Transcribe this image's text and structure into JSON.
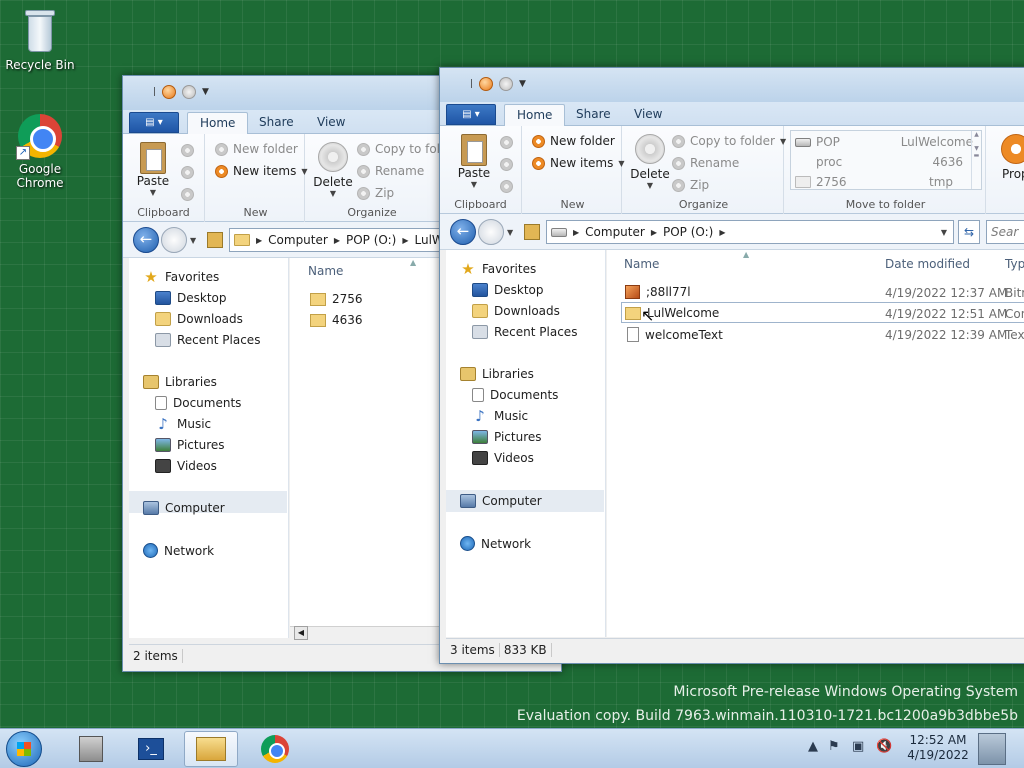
{
  "desktop": {
    "icons": [
      {
        "label": "Recycle Bin",
        "icon": "recycle-bin-icon"
      },
      {
        "label": "Google\nChrome",
        "icon": "chrome-icon"
      }
    ]
  },
  "window_back": {
    "tabs": [
      "Home",
      "Share",
      "View"
    ],
    "ribbon": {
      "paste": "Paste",
      "new_folder": "New folder",
      "new_items": "New items",
      "delete": "Delete",
      "copy_to": "Copy to fold",
      "rename": "Rename",
      "zip": "Zip",
      "groups": [
        "Clipboard",
        "New",
        "Organize"
      ]
    },
    "address": [
      "Computer",
      "POP (O:)",
      "LulW"
    ],
    "nav": {
      "favorites": "Favorites",
      "fav_items": [
        "Desktop",
        "Downloads",
        "Recent Places"
      ],
      "libraries": "Libraries",
      "lib_items": [
        "Documents",
        "Music",
        "Pictures",
        "Videos"
      ],
      "computer": "Computer",
      "network": "Network"
    },
    "column_name": "Name",
    "files": [
      "2756",
      "4636"
    ],
    "status": "2 items"
  },
  "window_front": {
    "tabs": [
      "Home",
      "Share",
      "View"
    ],
    "ribbon": {
      "paste": "Paste",
      "new_folder": "New folder",
      "new_items": "New items",
      "delete": "Delete",
      "copy_to": "Copy to folder",
      "rename": "Rename",
      "zip": "Zip",
      "move_list": [
        {
          "left": "POP",
          "right": "LulWelcome"
        },
        {
          "left": "proc",
          "right": "4636"
        },
        {
          "left": "2756",
          "right": "tmp"
        }
      ],
      "properties": "Prop",
      "groups": [
        "Clipboard",
        "New",
        "Organize",
        "Move to folder"
      ]
    },
    "address": [
      "Computer",
      "POP (O:)"
    ],
    "search_placeholder": "Sear",
    "nav": {
      "favorites": "Favorites",
      "fav_items": [
        "Desktop",
        "Downloads",
        "Recent Places"
      ],
      "libraries": "Libraries",
      "lib_items": [
        "Documents",
        "Music",
        "Pictures",
        "Videos"
      ],
      "computer": "Computer",
      "network": "Network"
    },
    "columns": {
      "name": "Name",
      "date": "Date modified",
      "type": "Typ"
    },
    "files": [
      {
        "name": ";88ll77l",
        "date": "4/19/2022 12:37 AM",
        "type": "Bitm",
        "icon": "bitmap-file-icon"
      },
      {
        "name": "LulWelcome",
        "date": "4/19/2022 12:51 AM",
        "type": "Con",
        "icon": "folder-icon"
      },
      {
        "name": "welcomeText",
        "date": "4/19/2022 12:39 AM",
        "type": "Text",
        "icon": "text-file-icon"
      }
    ],
    "status": {
      "count": "3 items",
      "size": "833 KB"
    }
  },
  "watermark": {
    "line1": "Microsoft Pre-release Windows Operating System",
    "line2": "Evaluation copy. Build 7963.winmain.110310-1721.bc1200a9b3dbbe5b"
  },
  "taskbar": {
    "clock_time": "12:52 AM",
    "clock_date": "4/19/2022"
  }
}
